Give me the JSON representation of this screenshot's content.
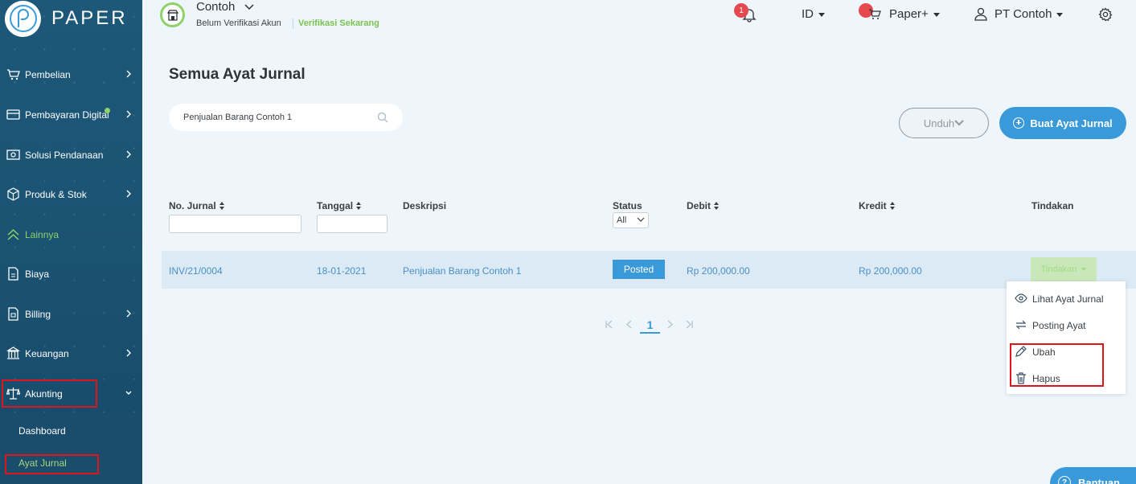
{
  "app": {
    "logo_text": "PAPER"
  },
  "sidebar": {
    "items": [
      {
        "label": "Pembelian",
        "icon": "cart-icon",
        "has_chevron": true
      },
      {
        "label": "Pembayaran Digital",
        "icon": "card-icon",
        "has_chevron": true,
        "has_dot": true
      },
      {
        "label": "Solusi Pendanaan",
        "icon": "money-icon",
        "has_chevron": true
      },
      {
        "label": "Produk & Stok",
        "icon": "box-icon",
        "has_chevron": true
      },
      {
        "label": "Lainnya",
        "icon": "chevrons-up-icon",
        "has_chevron": false
      },
      {
        "label": "Biaya",
        "icon": "document-icon",
        "has_chevron": false
      },
      {
        "label": "Billing",
        "icon": "billing-icon",
        "has_chevron": true
      },
      {
        "label": "Keuangan",
        "icon": "bank-icon",
        "has_chevron": true
      },
      {
        "label": "Akunting",
        "icon": "scale-icon",
        "has_chevron": true
      }
    ],
    "submenu": [
      {
        "label": "Dashboard"
      },
      {
        "label": "Ayat Jurnal",
        "active": true
      }
    ]
  },
  "header": {
    "company_name": "Contoh",
    "unverified": "Belum Verifikasi Akun",
    "verify_link": "Verifikasi Sekarang",
    "notification_count": "1",
    "language": "ID",
    "paper_plus": "Paper+",
    "user": "PT Contoh"
  },
  "main": {
    "title": "Semua Ayat Jurnal",
    "search_value": "Penjualan Barang Contoh 1",
    "download_label": "Unduh",
    "create_label": "Buat Ayat Jurnal",
    "columns": {
      "no_jurnal": "No. Jurnal",
      "tanggal": "Tanggal",
      "deskripsi": "Deskripsi",
      "status": "Status",
      "debit": "Debit",
      "kredit": "Kredit",
      "tindakan": "Tindakan"
    },
    "status_filter": "All",
    "rows": [
      {
        "no_jurnal": "INV/21/0004",
        "tanggal": "18-01-2021",
        "deskripsi": "Penjualan Barang Contoh 1",
        "status": "Posted",
        "debit": "Rp 200,000.00",
        "kredit": "Rp 200,000.00",
        "action_label": "Tindakan"
      }
    ],
    "action_menu": [
      {
        "label": "Lihat Ayat Jurnal",
        "icon": "eye-icon"
      },
      {
        "label": "Posting Ayat",
        "icon": "swap-icon"
      },
      {
        "label": "Ubah",
        "icon": "pencil-icon"
      },
      {
        "label": "Hapus",
        "icon": "trash-icon"
      }
    ],
    "pagination": {
      "current_page": "1"
    }
  },
  "help": {
    "label": "Bantuan"
  },
  "colors": {
    "sidebar_bg": "#1b5373",
    "accent": "#3a9ad9",
    "green": "#8fd16a",
    "highlight_box": "#e0151b"
  }
}
